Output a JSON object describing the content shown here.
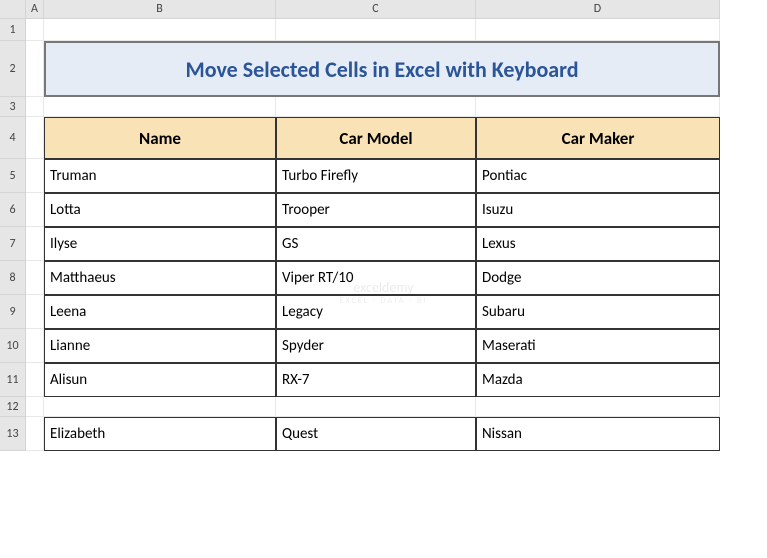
{
  "cols": [
    "A",
    "B",
    "C",
    "D"
  ],
  "rows": [
    "1",
    "2",
    "3",
    "4",
    "5",
    "6",
    "7",
    "8",
    "9",
    "10",
    "11",
    "12",
    "13"
  ],
  "title": "Move Selected Cells in Excel with Keyboard",
  "headers": {
    "b": "Name",
    "c": "Car Model",
    "d": "Car Maker"
  },
  "data": [
    {
      "b": "Truman",
      "c": "Turbo Firefly",
      "d": "Pontiac"
    },
    {
      "b": "Lotta",
      "c": "Trooper",
      "d": "Isuzu"
    },
    {
      "b": "Ilyse",
      "c": "GS",
      "d": "Lexus"
    },
    {
      "b": "Matthaeus",
      "c": "Viper RT/10",
      "d": "Dodge"
    },
    {
      "b": "Leena",
      "c": "Legacy",
      "d": "Subaru"
    },
    {
      "b": "Lianne",
      "c": "Spyder",
      "d": "Maserati"
    },
    {
      "b": "Alisun",
      "c": "RX-7",
      "d": "Mazda"
    }
  ],
  "separate": {
    "b": "Elizabeth",
    "c": "Quest",
    "d": "Nissan"
  },
  "watermark": {
    "main": "exceldemy",
    "sub": "EXCEL · DATA · BI"
  }
}
